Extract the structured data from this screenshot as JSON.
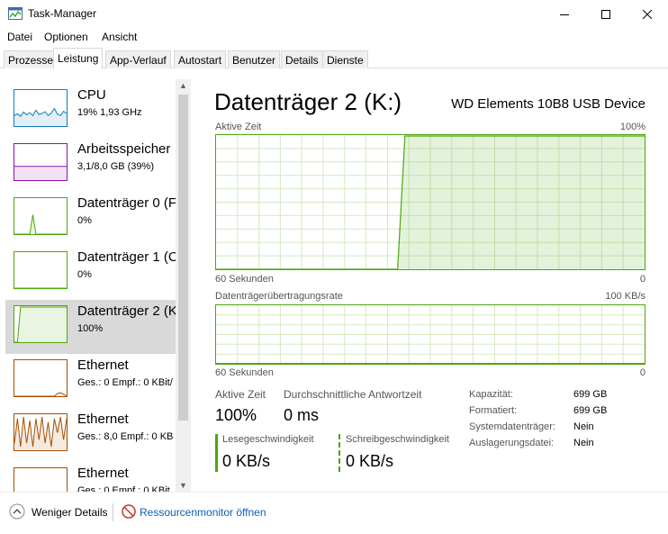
{
  "window": {
    "title": "Task-Manager"
  },
  "menu": [
    "Datei",
    "Optionen",
    "Ansicht"
  ],
  "tabs": [
    "Prozesse",
    "Leistung",
    "App-Verlauf",
    "Autostart",
    "Benutzer",
    "Details",
    "Dienste"
  ],
  "active_tab": "Leistung",
  "sidebar": [
    {
      "name": "CPU",
      "sub": "19%  1,93 GHz",
      "color": "#117dbb",
      "selected": false,
      "graph": [
        0.3,
        0.35,
        0.28,
        0.4,
        0.32,
        0.38,
        0.3,
        0.45,
        0.33,
        0.36,
        0.41,
        0.3,
        0.37,
        0.5,
        0.34,
        0.3,
        0.42,
        0.36
      ]
    },
    {
      "name": "Arbeitsspeicher",
      "sub": "3,1/8,0 GB (39%)",
      "color": "#8b12ae",
      "selected": false,
      "graph": [
        0.39,
        0.39,
        0.39,
        0.39,
        0.39,
        0.39,
        0.39,
        0.39,
        0.39,
        0.39,
        0.39,
        0.39,
        0.39,
        0.39,
        0.39,
        0.39,
        0.39,
        0.39
      ]
    },
    {
      "name": "Datenträger 0 (F",
      "sub": "0%",
      "color": "#4da60c",
      "selected": false,
      "graph": [
        0,
        0,
        0,
        0,
        0,
        0,
        0.55,
        0,
        0,
        0,
        0,
        0,
        0,
        0,
        0,
        0,
        0,
        0
      ]
    },
    {
      "name": "Datenträger 1 (C",
      "sub": "0%",
      "color": "#4da60c",
      "selected": false,
      "graph": [
        0,
        0,
        0,
        0,
        0,
        0,
        0,
        0,
        0,
        0,
        0,
        0,
        0,
        0,
        0,
        0,
        0,
        0
      ]
    },
    {
      "name": "Datenträger 2 (K",
      "sub": "100%",
      "color": "#4da60c",
      "selected": true,
      "graph": [
        0,
        0,
        1,
        1,
        1,
        1,
        1,
        1,
        1,
        1,
        1,
        1,
        1,
        1,
        1,
        1,
        1,
        1
      ]
    },
    {
      "name": "Ethernet",
      "sub": "Ges.: 0  Empf.: 0 KBit/",
      "color": "#a74f01",
      "selected": false,
      "graph": [
        0,
        0,
        0,
        0,
        0,
        0,
        0,
        0,
        0,
        0,
        0,
        0,
        0,
        0,
        0.08,
        0.1,
        0.06,
        0
      ]
    },
    {
      "name": "Ethernet",
      "sub": "Ges.: 8,0  Empf.: 0 KB",
      "color": "#a74f01",
      "selected": false,
      "graph": [
        0.2,
        0.9,
        0.1,
        0.95,
        0.2,
        0.85,
        0.1,
        0.9,
        0.3,
        0.95,
        0.2,
        0.8,
        0.1,
        0.9,
        0.5,
        0.95,
        0.3,
        0.9
      ]
    },
    {
      "name": "Ethernet",
      "sub": "Ges.: 0  Empf.: 0 KBit",
      "color": "#a74f01",
      "selected": false,
      "graph": [
        0,
        0,
        0,
        0,
        0,
        0,
        0,
        0,
        0,
        0,
        0,
        0,
        0,
        0,
        0,
        0,
        0,
        0
      ]
    }
  ],
  "main": {
    "title": "Datenträger 2 (K:)",
    "device": "WD Elements 10B8 USB Device",
    "graph1": {
      "label": "Aktive Zeit",
      "max": "100%",
      "left_label": "60 Sekunden",
      "right_label": "0",
      "values": [
        0,
        0,
        0,
        0,
        0,
        0,
        0,
        0,
        0,
        0,
        0,
        0,
        0,
        0,
        0,
        0,
        0,
        0,
        0,
        0,
        0,
        0,
        0,
        0,
        0,
        0,
        1,
        1,
        1,
        1,
        1,
        1,
        1,
        1,
        1,
        1,
        1,
        1,
        1,
        1,
        1,
        1,
        1,
        1,
        1,
        1,
        1,
        1,
        1,
        1,
        1,
        1,
        1,
        1,
        1,
        1,
        1,
        1,
        1,
        1
      ]
    },
    "graph2": {
      "label": "Datenträgerübertragungsrate",
      "max": "100 KB/s",
      "left_label": "60 Sekunden",
      "right_label": "0"
    },
    "stats": {
      "active_time_label": "Aktive Zeit",
      "active_time_value": "100%",
      "resp_label": "Durchschnittliche Antwortzeit",
      "resp_value": "0 ms",
      "read_label": "Lesegeschwindigkeit",
      "read_value": "0 KB/s",
      "write_label": "Schreibgeschwindigkeit",
      "write_value": "0 KB/s"
    },
    "props": [
      {
        "k": "Kapazität:",
        "v": "699 GB"
      },
      {
        "k": "Formatiert:",
        "v": "699 GB"
      },
      {
        "k": "Systemdatenträger:",
        "v": "Nein"
      },
      {
        "k": "Auslagerungsdatei:",
        "v": "Nein"
      }
    ]
  },
  "footer": {
    "fewer": "Weniger Details",
    "monitor": "Ressourcenmonitor öffnen"
  },
  "colors": {
    "disk": "#4da60c",
    "disk_fill": "#eef6e6",
    "grid": "#d4e9c3"
  }
}
